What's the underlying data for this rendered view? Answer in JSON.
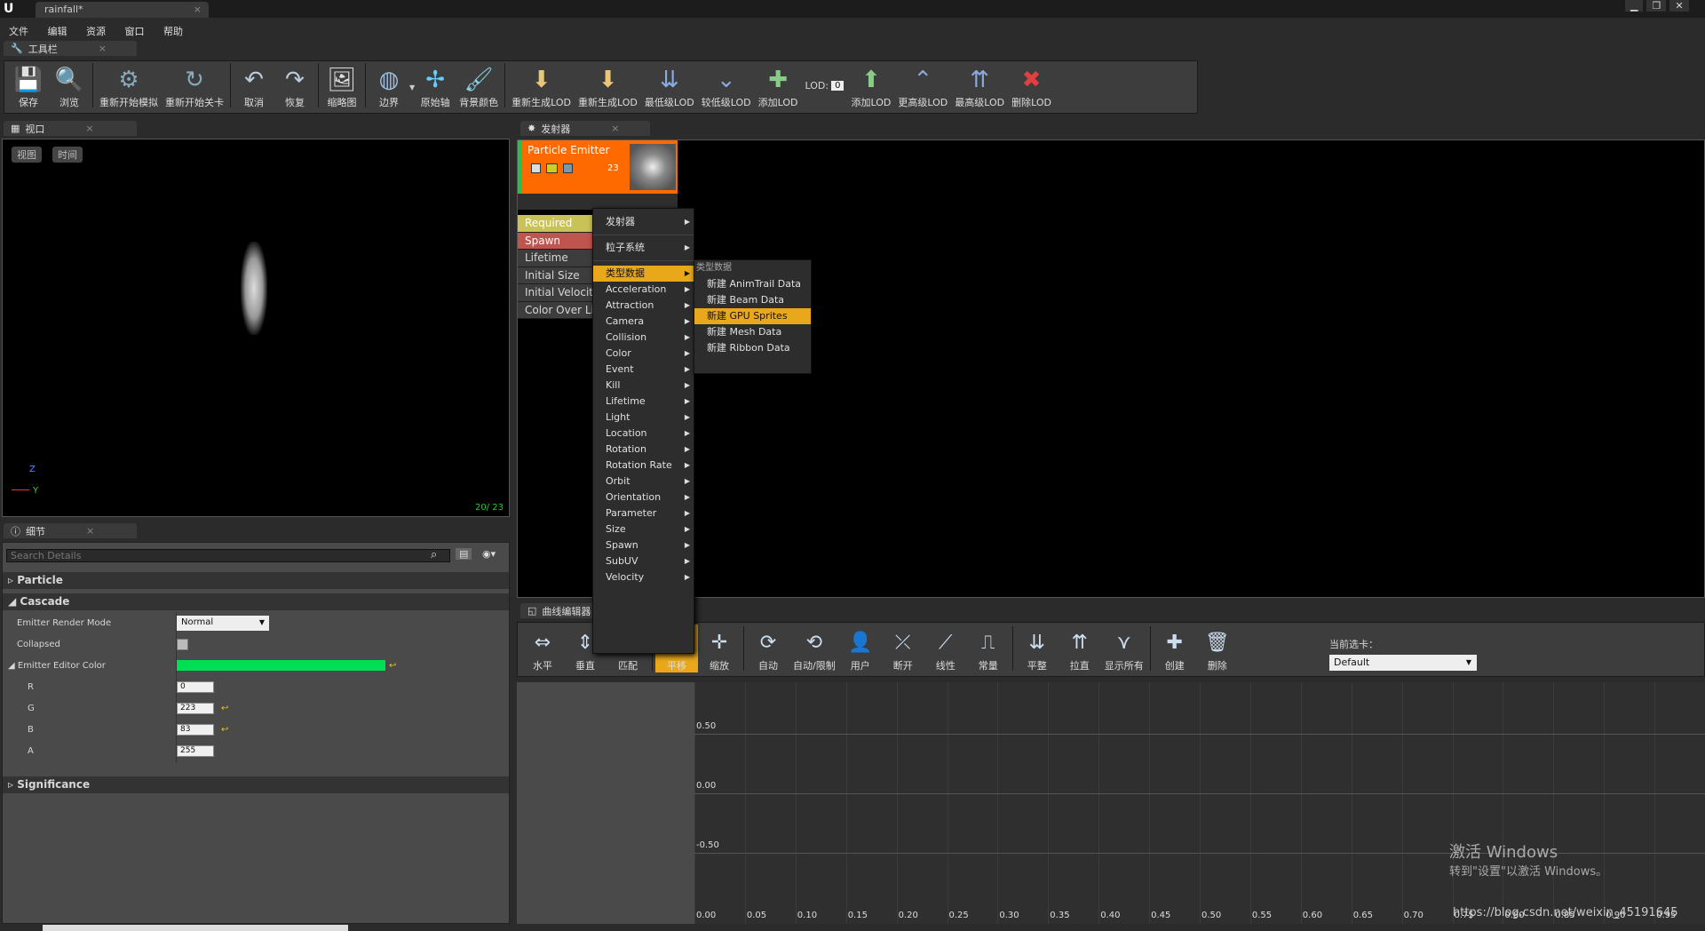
{
  "window": {
    "doc_tab": "rainfall*",
    "controls": [
      "▁",
      "❐",
      "✕"
    ]
  },
  "menubar": [
    "文件",
    "编辑",
    "资源",
    "窗口",
    "帮助"
  ],
  "toolbar_tab": "工具栏",
  "toolbar": {
    "buttons": [
      {
        "label": "保存",
        "icon": "save-icon"
      },
      {
        "label": "浏览",
        "icon": "browse-icon"
      },
      {
        "label": "重新开始模拟",
        "icon": "restart-sim-icon"
      },
      {
        "label": "重新开始关卡",
        "icon": "restart-level-icon"
      },
      {
        "label": "取消",
        "icon": "undo-icon"
      },
      {
        "label": "恢复",
        "icon": "redo-icon"
      },
      {
        "label": "缩略图",
        "icon": "thumbnail-icon"
      },
      {
        "label": "边界",
        "icon": "bounds-icon"
      },
      {
        "label": "原始轴",
        "icon": "origin-axis-icon"
      },
      {
        "label": "背景颜色",
        "icon": "bg-color-icon"
      },
      {
        "label": "重新生成LOD",
        "icon": "regen-lod-icon"
      },
      {
        "label": "重新生成LOD",
        "icon": "regen-lod-2-icon"
      },
      {
        "label": "最低级LOD",
        "icon": "lowest-lod-icon"
      },
      {
        "label": "较低级LOD",
        "icon": "lower-lod-icon"
      },
      {
        "label": "添加LOD",
        "icon": "add-lod-icon"
      }
    ],
    "lod_label": "LOD:",
    "lod_value": "0",
    "buttons_right": [
      {
        "label": "添加LOD",
        "icon": "add-lod-2-icon"
      },
      {
        "label": "更高级LOD",
        "icon": "higher-lod-icon"
      },
      {
        "label": "最高级LOD",
        "icon": "highest-lod-icon"
      },
      {
        "label": "删除LOD",
        "icon": "delete-lod-icon"
      }
    ]
  },
  "viewport": {
    "tab": "视口",
    "view_btn": "视图",
    "time_btn": "时间",
    "counter": "20/ 23",
    "axis_z": "Z",
    "axis_y": "Y"
  },
  "emitter": {
    "tab": "发射器",
    "name": "Particle Emitter",
    "count": "23",
    "modules": [
      "Required",
      "Spawn",
      "Lifetime",
      "Initial Size",
      "Initial Velocit",
      "Color Over Li"
    ]
  },
  "context_menu": {
    "top_items": [
      "发射器",
      "粒子系统"
    ],
    "highlight": "类型数据",
    "items": [
      "Acceleration",
      "Attraction",
      "Camera",
      "Collision",
      "Color",
      "Event",
      "Kill",
      "Lifetime",
      "Light",
      "Location",
      "Rotation",
      "Rotation Rate",
      "Orbit",
      "Orientation",
      "Parameter",
      "Size",
      "Spawn",
      "SubUV",
      "Velocity"
    ]
  },
  "submenu": {
    "header": "类型数据",
    "items": [
      "新建 AnimTrail Data",
      "新建 Beam Data",
      "新建 GPU Sprites",
      "新建 Mesh Data",
      "新建 Ribbon Data"
    ],
    "highlighted": "新建 GPU Sprites"
  },
  "details": {
    "tab": "细节",
    "search_placeholder": "Search Details",
    "sections": [
      "Particle",
      "Cascade",
      "Significance"
    ],
    "render_mode_label": "Emitter Render Mode",
    "render_mode_value": "Normal",
    "collapsed_label": "Collapsed",
    "editor_color_label": "Emitter Editor Color",
    "color_hex": "#00df53",
    "r_label": "R",
    "r_value": "0",
    "g_label": "G",
    "g_value": "223",
    "b_label": "B",
    "b_value": "83",
    "a_label": "A",
    "a_value": "255"
  },
  "curve_editor": {
    "tab": "曲线编辑器",
    "buttons": [
      "水平",
      "垂直",
      "匹配",
      "平移",
      "缩放",
      "自动",
      "自动/限制",
      "用户",
      "断开",
      "线性",
      "常量",
      "平整",
      "拉直",
      "显示所有",
      "创建",
      "删除"
    ],
    "current_tab_label": "当前选卡：",
    "current_tab_value": "Default",
    "y_labels": [
      "0.50",
      "0.00",
      "-0.50"
    ],
    "x_labels": [
      "0.00",
      "0.05",
      "0.10",
      "0.15",
      "0.20",
      "0.25",
      "0.30",
      "0.35",
      "0.40",
      "0.45",
      "0.50",
      "0.55",
      "0.60",
      "0.65",
      "0.70",
      "0.75",
      "0.80",
      "0.85",
      "0.90",
      "0.95"
    ]
  },
  "watermark": {
    "line1": "激活 Windows",
    "line2": "转到\"设置\"以激活 Windows。",
    "url": "https://blog.csdn.net/weixin_45191645"
  },
  "colors": {
    "accent": "#e9a81c",
    "emitter_orange": "#ff6a00",
    "required_yellow": "#c9c257",
    "spawn_red": "#c0544f"
  }
}
